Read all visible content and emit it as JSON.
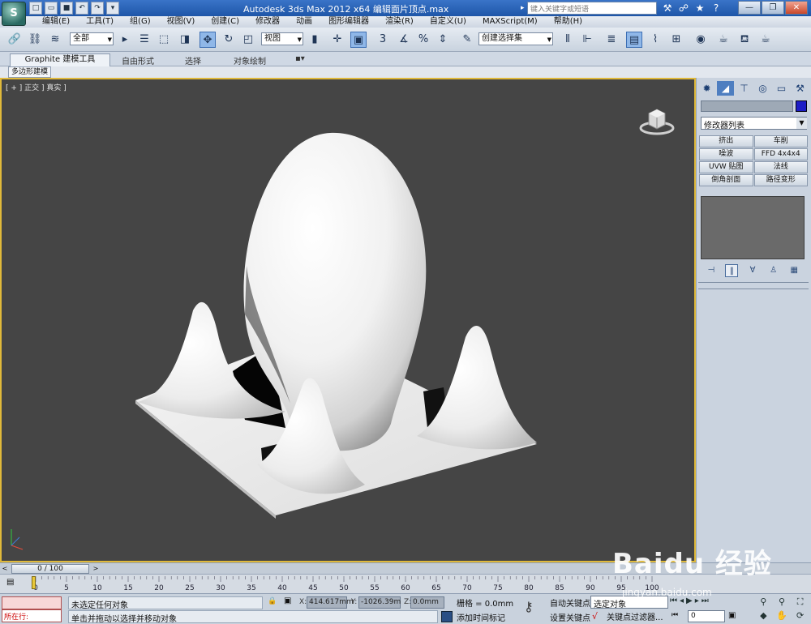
{
  "app": {
    "logo_text": "S",
    "window_title": "Autodesk 3ds Max  2012 x64      编辑面片顶点.max",
    "search_placeholder": "键入关键字或短语",
    "window_controls": [
      "—",
      "❐",
      "✕"
    ]
  },
  "menu": [
    "编辑(E)",
    "工具(T)",
    "组(G)",
    "视图(V)",
    "创建(C)",
    "修改器",
    "动画",
    "图形编辑器",
    "渲染(R)",
    "自定义(U)",
    "MAXScript(M)",
    "帮助(H)"
  ],
  "toolbar": {
    "selection_filter": "全部",
    "reference_coord": "视图",
    "named_selection": "创建选择集"
  },
  "ribbon": {
    "tabs": [
      "Graphite 建模工具",
      "自由形式",
      "选择",
      "对象绘制"
    ],
    "sub_tab": "多边形建模"
  },
  "viewport": {
    "label": "[ + ] 正交 ] 真实 ]"
  },
  "command_panel": {
    "modifier_list": "修改器列表",
    "modifier_buttons": [
      "挤出",
      "车削",
      "噪波",
      "FFD 4x4x4",
      "UVW 贴图",
      "法线",
      "倒角剖面",
      "路径变形"
    ],
    "object_color": "#1d1dc5"
  },
  "timeline": {
    "slider_label": "0 / 100",
    "ticks": [
      "0",
      "5",
      "10",
      "15",
      "20",
      "25",
      "30",
      "35",
      "40",
      "45",
      "50",
      "55",
      "60",
      "65",
      "70",
      "75",
      "80",
      "85",
      "90",
      "95",
      "100"
    ]
  },
  "status": {
    "maxscript_running": "所在行:",
    "line1": "未选定任何对象",
    "line2": "单击并拖动以选择并移动对象",
    "x_label": "X:",
    "x_value": "414.617mm",
    "y_label": "Y:",
    "y_value": "-1026.39m",
    "z_label": "Z:",
    "z_value": "0.0mm",
    "grid": "栅格 = 0.0mm",
    "add_time_tag": "添加时间标记",
    "auto_key": "自动关键点",
    "set_key": "设置关键点",
    "selection_dropdown": "选定对象",
    "key_filters": "关键点过滤器...",
    "frame": "0"
  },
  "watermark": {
    "brand": "Baidu 经验",
    "url": "jingyan.baidu.com"
  }
}
